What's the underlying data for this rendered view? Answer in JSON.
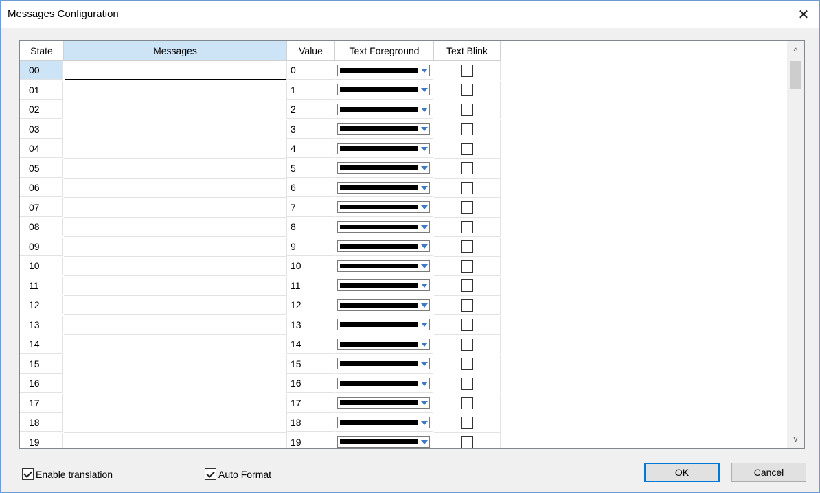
{
  "window": {
    "title": "Messages Configuration",
    "close_glyph": "✕"
  },
  "grid": {
    "columns": [
      "State",
      "Messages",
      "Value",
      "Text Foreground",
      "Text Blink"
    ],
    "rows": [
      {
        "state": "00",
        "message": "",
        "value": "0",
        "foreground": "#000000",
        "blink": false
      },
      {
        "state": "01",
        "message": "",
        "value": "1",
        "foreground": "#000000",
        "blink": false
      },
      {
        "state": "02",
        "message": "",
        "value": "2",
        "foreground": "#000000",
        "blink": false
      },
      {
        "state": "03",
        "message": "",
        "value": "3",
        "foreground": "#000000",
        "blink": false
      },
      {
        "state": "04",
        "message": "",
        "value": "4",
        "foreground": "#000000",
        "blink": false
      },
      {
        "state": "05",
        "message": "",
        "value": "5",
        "foreground": "#000000",
        "blink": false
      },
      {
        "state": "06",
        "message": "",
        "value": "6",
        "foreground": "#000000",
        "blink": false
      },
      {
        "state": "07",
        "message": "",
        "value": "7",
        "foreground": "#000000",
        "blink": false
      },
      {
        "state": "08",
        "message": "",
        "value": "8",
        "foreground": "#000000",
        "blink": false
      },
      {
        "state": "09",
        "message": "",
        "value": "9",
        "foreground": "#000000",
        "blink": false
      },
      {
        "state": "10",
        "message": "",
        "value": "10",
        "foreground": "#000000",
        "blink": false
      },
      {
        "state": "11",
        "message": "",
        "value": "11",
        "foreground": "#000000",
        "blink": false
      },
      {
        "state": "12",
        "message": "",
        "value": "12",
        "foreground": "#000000",
        "blink": false
      },
      {
        "state": "13",
        "message": "",
        "value": "13",
        "foreground": "#000000",
        "blink": false
      },
      {
        "state": "14",
        "message": "",
        "value": "14",
        "foreground": "#000000",
        "blink": false
      },
      {
        "state": "15",
        "message": "",
        "value": "15",
        "foreground": "#000000",
        "blink": false
      },
      {
        "state": "16",
        "message": "",
        "value": "16",
        "foreground": "#000000",
        "blink": false
      },
      {
        "state": "17",
        "message": "",
        "value": "17",
        "foreground": "#000000",
        "blink": false
      },
      {
        "state": "18",
        "message": "",
        "value": "18",
        "foreground": "#000000",
        "blink": false
      },
      {
        "state": "19",
        "message": "",
        "value": "19",
        "foreground": "#000000",
        "blink": false
      }
    ],
    "selected_row": 0,
    "scroll_up_glyph": "^",
    "scroll_down_glyph": "v"
  },
  "footer": {
    "enable_translation": {
      "label": "Enable translation",
      "checked": true
    },
    "auto_format": {
      "label": "Auto Format",
      "checked": true
    },
    "ok_label": "OK",
    "cancel_label": "Cancel"
  },
  "colors": {
    "selection": "#cde4f7",
    "accent": "#0078d7",
    "dropdown_arrow": "#3d78c6"
  }
}
